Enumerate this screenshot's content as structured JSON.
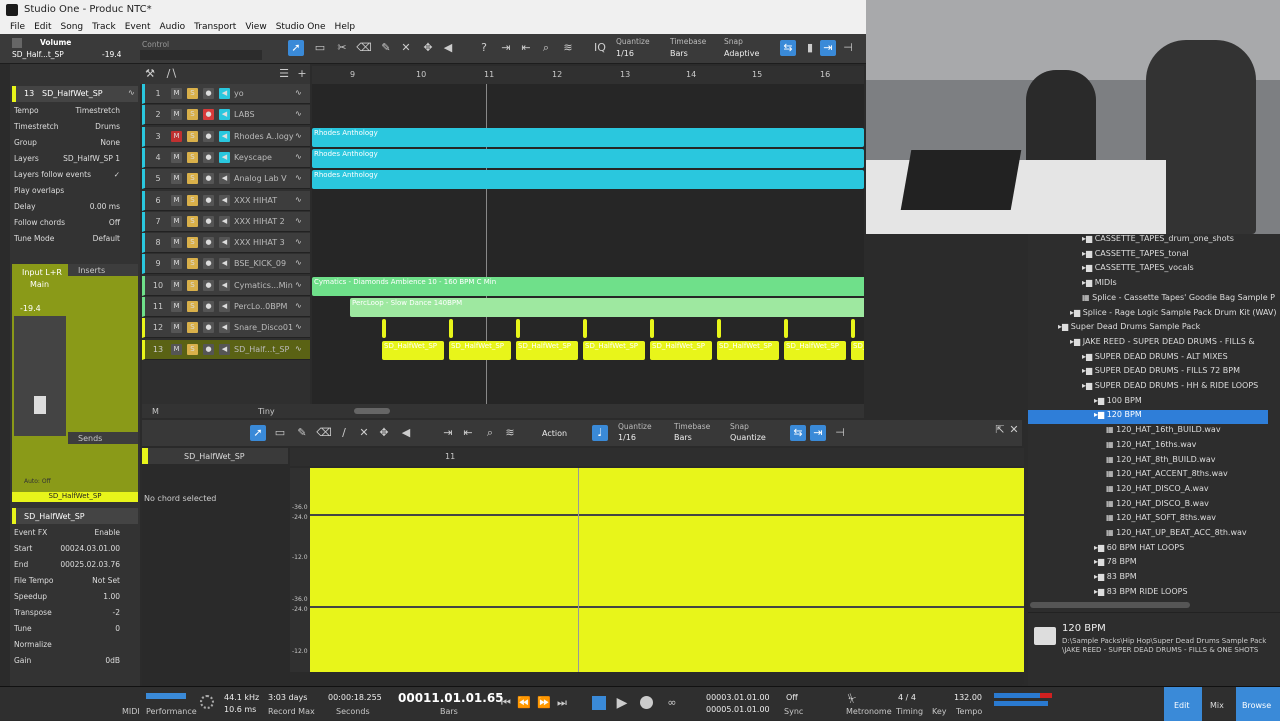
{
  "window": {
    "title": "Studio One - Produc NTC*"
  },
  "menu": [
    "File",
    "Edit",
    "Song",
    "Track",
    "Event",
    "Audio",
    "Transport",
    "View",
    "Studio One",
    "Help"
  ],
  "toolbar": {
    "volume_label": "Volume",
    "track_name": "SD_Half...t_SP",
    "volume_value": "-19.4",
    "control_label": "Control",
    "quantize_label": "Quantize",
    "quantize_value": "1/16",
    "timebase_label": "Timebase",
    "timebase_value": "Bars",
    "snap_label": "Snap",
    "snap_value": "Adaptive"
  },
  "ruler": [
    "9",
    "10",
    "11",
    "12",
    "13",
    "14",
    "15",
    "16"
  ],
  "inspector": {
    "track_num": "13",
    "track_name": "SD_HalfWet_SP",
    "rows": [
      {
        "k": "Tempo",
        "v": "Timestretch"
      },
      {
        "k": "Timestretch",
        "v": "Drums"
      },
      {
        "k": "Group",
        "v": "None"
      },
      {
        "k": "Layers",
        "v": "SD_HalfW_SP 1"
      },
      {
        "k": "Layers follow events",
        "v": "✓"
      },
      {
        "k": "Play overlaps",
        "v": ""
      },
      {
        "k": "Delay",
        "v": "0.00 ms"
      },
      {
        "k": "Follow chords",
        "v": "Off"
      },
      {
        "k": "Tune Mode",
        "v": "Default"
      }
    ],
    "input": "Input L+R",
    "output": "Main",
    "fader_value": "-19.4",
    "inserts": "Inserts",
    "sends": "Sends",
    "auto": "Auto: Off",
    "channel_name": "SD_HalfWet_SP",
    "event_name": "SD_HalfWet_SP",
    "event_fx": "Event FX",
    "enable": "Enable",
    "event_rows": [
      {
        "k": "Start",
        "v": "00024.03.01.00"
      },
      {
        "k": "End",
        "v": "00025.02.03.76"
      },
      {
        "k": "File Tempo",
        "v": "Not Set"
      },
      {
        "k": "Speedup",
        "v": "1.00"
      },
      {
        "k": "Transpose",
        "v": "-2"
      },
      {
        "k": "Tune",
        "v": "0"
      },
      {
        "k": "Normalize",
        "v": ""
      },
      {
        "k": "Gain",
        "v": "0dB"
      }
    ]
  },
  "tracks": [
    {
      "n": "1",
      "name": "yo"
    },
    {
      "n": "2",
      "name": "LABS"
    },
    {
      "n": "3",
      "name": "Rhodes A..logy"
    },
    {
      "n": "4",
      "name": "Keyscape"
    },
    {
      "n": "5",
      "name": "Analog Lab V"
    },
    {
      "n": "6",
      "name": "XXX HIHAT"
    },
    {
      "n": "7",
      "name": "XXX HIHAT 2"
    },
    {
      "n": "8",
      "name": "XXX HIHAT 3"
    },
    {
      "n": "9",
      "name": "BSE_KICK_09"
    },
    {
      "n": "10",
      "name": "Cymatics...Min"
    },
    {
      "n": "11",
      "name": "PercLo..0BPM"
    },
    {
      "n": "12",
      "name": "Snare_Disco01"
    },
    {
      "n": "13",
      "name": "SD_Half...t_SP"
    }
  ],
  "clips": {
    "rhodes": "Rhodes Anthology",
    "cymatics": "Cymatics - Diamonds Ambience 10 - 160 BPM C Min",
    "cymatics2": "Cymatics - Diamonds Ambience 10",
    "perc": "PercLoop - Slow Dance 140BPM",
    "sd": "SD_HalfWet_SP"
  },
  "arr_footer": {
    "m": "M",
    "zoom": "Tiny"
  },
  "editor": {
    "action": "Action",
    "quantize_label": "Quantize",
    "quantize_value": "1/16",
    "timebase_label": "Timebase",
    "timebase_value": "Bars",
    "snap_label": "Snap",
    "snap_value": "Quantize",
    "track_name": "SD_HalfWet_SP",
    "chord": "No chord selected",
    "bar": "11",
    "db_labels": [
      "-∞",
      "-36.0",
      "-24.0",
      "-12.0",
      "-36.0",
      "-24.0",
      "-12.0"
    ]
  },
  "browser": {
    "items": [
      {
        "t": "CASSETTE_TAPES_drum_one_shots",
        "ind": 3,
        "f": "folder"
      },
      {
        "t": "CASSETTE_TAPES_tonal",
        "ind": 3,
        "f": "folder"
      },
      {
        "t": "CASSETTE_TAPES_vocals",
        "ind": 3,
        "f": "folder"
      },
      {
        "t": "MIDIs",
        "ind": 3,
        "f": "folder"
      },
      {
        "t": "Splice - Cassette Tapes' Goodie Bag Sample P",
        "ind": 3,
        "f": "file"
      },
      {
        "t": "Splice - Rage Logic Sample Pack Drum Kit (WAV)",
        "ind": 2,
        "f": "folder"
      },
      {
        "t": "Super Dead Drums Sample Pack",
        "ind": 1,
        "f": "folder"
      },
      {
        "t": "JAKE REED - SUPER DEAD DRUMS - FILLS &",
        "ind": 2,
        "f": "folder"
      },
      {
        "t": "SUPER DEAD DRUMS - ALT MIXES",
        "ind": 3,
        "f": "folder"
      },
      {
        "t": "SUPER DEAD DRUMS - FILLS 72 BPM",
        "ind": 3,
        "f": "folder"
      },
      {
        "t": "SUPER DEAD DRUMS - HH & RIDE LOOPS",
        "ind": 3,
        "f": "folder"
      },
      {
        "t": "100 BPM",
        "ind": 4,
        "f": "folder"
      },
      {
        "t": "120 BPM",
        "ind": 4,
        "f": "folder",
        "sel": true
      },
      {
        "t": "120_HAT_16th_BUILD.wav",
        "ind": 5,
        "f": "file"
      },
      {
        "t": "120_HAT_16ths.wav",
        "ind": 5,
        "f": "file"
      },
      {
        "t": "120_HAT_8th_BUILD.wav",
        "ind": 5,
        "f": "file"
      },
      {
        "t": "120_HAT_ACCENT_8ths.wav",
        "ind": 5,
        "f": "file"
      },
      {
        "t": "120_HAT_DISCO_A.wav",
        "ind": 5,
        "f": "file"
      },
      {
        "t": "120_HAT_DISCO_B.wav",
        "ind": 5,
        "f": "file"
      },
      {
        "t": "120_HAT_SOFT_8ths.wav",
        "ind": 5,
        "f": "file"
      },
      {
        "t": "120_HAT_UP_BEAT_ACC_8th.wav",
        "ind": 5,
        "f": "file"
      },
      {
        "t": "60 BPM HAT LOOPS",
        "ind": 4,
        "f": "folder"
      },
      {
        "t": "78 BPM",
        "ind": 4,
        "f": "folder"
      },
      {
        "t": "83 BPM",
        "ind": 4,
        "f": "folder"
      },
      {
        "t": "83 BPM RIDE LOOPS",
        "ind": 4,
        "f": "folder"
      }
    ],
    "caption_title": "120 BPM",
    "caption_path1": "D:\\Sample Packs\\Hip Hop\\Super Dead Drums Sample Pack",
    "caption_path2": "\\JAKE REED - SUPER DEAD DRUMS - FILLS & ONE SHOTS"
  },
  "transport": {
    "midi": "MIDI",
    "performance": "Performance",
    "sample_rate": "44.1 kHz",
    "latency": "10.6 ms",
    "record_max": "3:03 days",
    "record_max_label": "Record Max",
    "seconds": "00:00:18.255",
    "seconds_label": "Seconds",
    "bars": "00011.01.01.65",
    "bars_label": "Bars",
    "loop_start": "00003.01.01.00",
    "loop_end": "00005.01.01.00",
    "sync_value": "Off",
    "sync_label": "Sync",
    "metronome": "Metronome",
    "timing_value": "4 / 4",
    "timing_label": "Timing",
    "key_label": "Key",
    "tempo_value": "132.00",
    "tempo_label": "Tempo",
    "edit": "Edit",
    "mix": "Mix",
    "browse": "Browse"
  },
  "colors": {
    "accent": "#3a8ad8",
    "yellow": "#e8f51a",
    "cyan": "#2ac7de",
    "green": "#6fe08a",
    "olive": "#8a9a18"
  }
}
